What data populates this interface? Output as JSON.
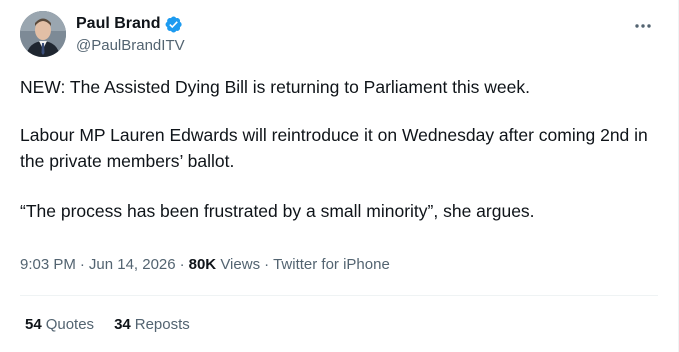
{
  "author": {
    "display_name": "Paul Brand",
    "handle": "@PaulBrandITV",
    "verified_icon": "verified-badge-icon",
    "accent_color": "#1d9bf0"
  },
  "tweet": {
    "paragraphs": [
      "NEW: The Assisted Dying Bill is returning to Parliament this week.",
      "Labour MP Lauren Edwards will reintroduce it on Wednesday after coming 2nd in the private members’ ballot.",
      "“The process has been frustrated by a small minority”, she argues."
    ]
  },
  "meta": {
    "time": "9:03 PM",
    "date": "Jun 14, 2026",
    "views_count": "80K",
    "views_label": "Views",
    "source": "Twitter for iPhone",
    "separator": "·"
  },
  "stats": {
    "quotes_count": "54",
    "quotes_label": "Quotes",
    "reposts_count": "34",
    "reposts_label": "Reposts"
  }
}
